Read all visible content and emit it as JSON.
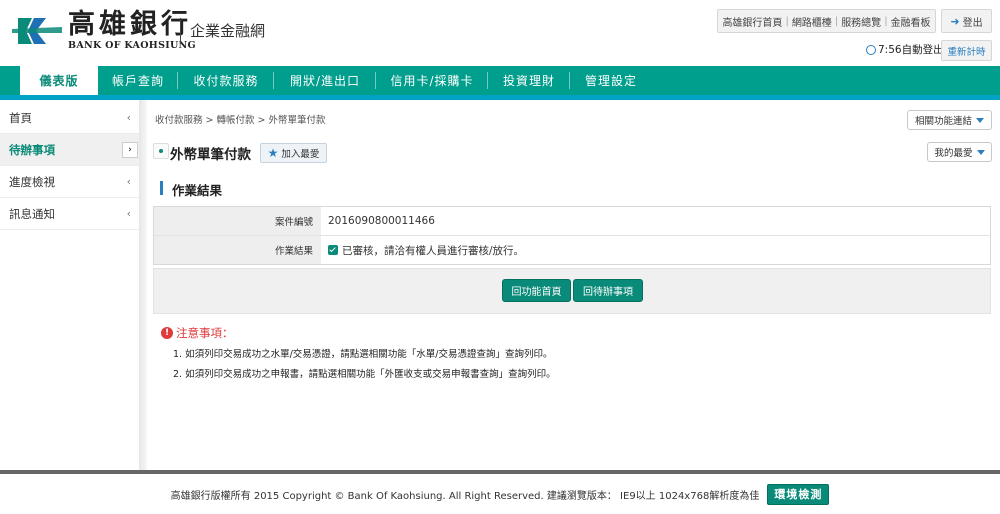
{
  "brand": {
    "name_cn": "高雄銀行",
    "name_en": "BANK OF KAOHSIUNG",
    "subtitle": "企業金融網",
    "brand_color": "#0a8a78"
  },
  "top_links": [
    "高雄銀行首頁",
    "網路櫃檯",
    "服務總覽",
    "金融看板"
  ],
  "logout_label": "登出",
  "session": {
    "time_text": "7:56自動登出",
    "reset_label": "重新計時"
  },
  "nav": {
    "items": [
      {
        "label": "儀表版"
      },
      {
        "label": "帳戶查詢"
      },
      {
        "label": "收付款服務"
      },
      {
        "label": "開狀/進出口"
      },
      {
        "label": "信用卡/採購卡"
      },
      {
        "label": "投資理財"
      },
      {
        "label": "管理設定"
      }
    ]
  },
  "sidebar": {
    "items": [
      {
        "label": "首頁"
      },
      {
        "label": "待辦事項"
      },
      {
        "label": "進度檢視"
      },
      {
        "label": "訊息通知"
      }
    ]
  },
  "breadcrumb": "收付款服務 > 轉帳付款 > 外幣單筆付款",
  "related_functions_label": "相關功能連結",
  "my_favorites_label": "我的最愛",
  "page_title": "外幣單筆付款",
  "add_favorite_label": "加入最愛",
  "section_title": "作業結果",
  "result": {
    "rows": [
      {
        "label": "案件編號",
        "value": "2016090800011466"
      },
      {
        "label": "作業結果",
        "value": "已審核，請洽有權人員進行審核/放行。"
      }
    ]
  },
  "buttons": {
    "back_home": "回功能首頁",
    "back_todo": "回待辦事項"
  },
  "notice": {
    "title": "注意事項：",
    "lines": [
      "1. 如須列印交易成功之水單/交易憑證，請點選相關功能「水單/交易憑證查詢」查詢列印。",
      "2. 如須列印交易成功之申報書，請點選相關功能「外匯收支或交易申報書查詢」查詢列印。"
    ]
  },
  "footer": {
    "copyright": "高雄銀行版權所有 2015 Copyright © Bank Of Kaohsiung. All Right Reserved. 建議瀏覽版本： IE9以上 1024x768解析度為佳",
    "env_check_label": "環境檢測"
  }
}
